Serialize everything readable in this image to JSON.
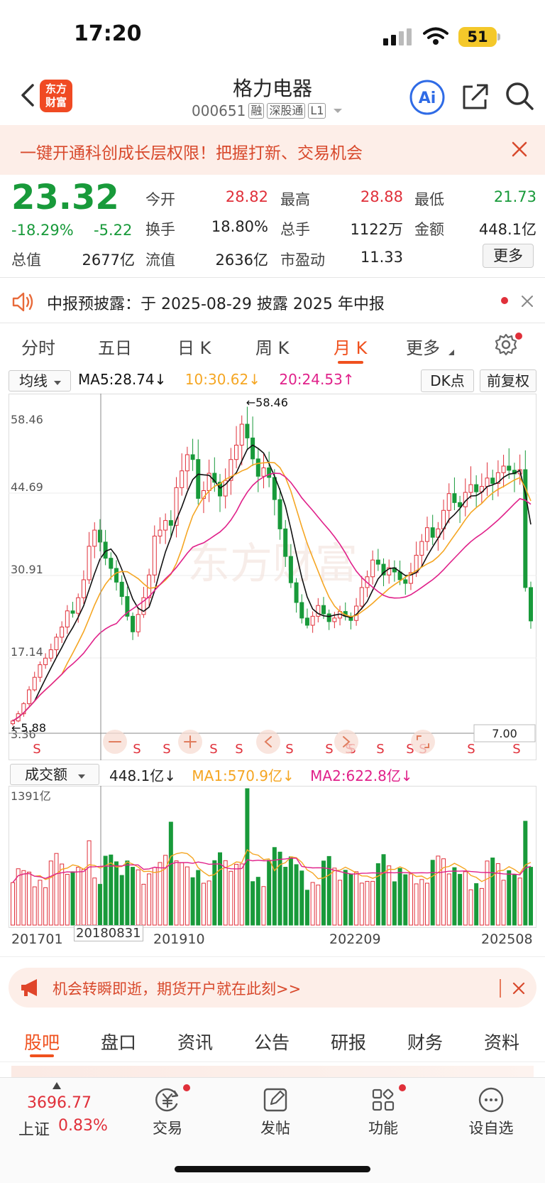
{
  "status_bar": {
    "time": "17:20",
    "battery": "51"
  },
  "header": {
    "title": "格力电器",
    "code": "000651",
    "tags": [
      "融",
      "深股通",
      "L1"
    ],
    "logo_line1": "东方",
    "logo_line2": "财富",
    "ai_label": "Ai"
  },
  "promo": {
    "text": "一键开通科创成长层权限！把握打新、交易机会"
  },
  "quote": {
    "price": "23.32",
    "change_pct": "-18.29%",
    "change": "-5.22",
    "open_label": "今开",
    "open": "28.82",
    "high_label": "最高",
    "high": "28.88",
    "low_label": "最低",
    "low": "21.73",
    "turnover_label": "换手",
    "turnover": "18.80%",
    "volume_label": "总手",
    "volume": "1122万",
    "amount_label": "金额",
    "amount": "448.1亿",
    "mktcap_label": "总值",
    "mktcap": "2677亿",
    "float_label": "流值",
    "float": "2636亿",
    "pe_label": "市盈动",
    "pe": "11.33",
    "more_label": "更多"
  },
  "notice": {
    "text": "中报预披露：于 2025-08-29 披露 2025 年中报"
  },
  "period_tabs": [
    "分时",
    "五日",
    "日 K",
    "周 K",
    "月 K",
    "更多"
  ],
  "active_period": "月 K",
  "chart_toolbar": {
    "ma_select": "均线",
    "ma5": "MA5:28.74↓",
    "ma10": "10:30.62↓",
    "ma20": "20:24.53↑",
    "dk_label": "DK点",
    "adjust_label": "前复权"
  },
  "volume_toolbar": {
    "select": "成交额",
    "value": "448.1亿↓",
    "ma1": "MA1:570.9亿↓",
    "ma2": "MA2:622.8亿↓"
  },
  "ad": {
    "text": "机会转瞬即逝，期货开户就在此刻>>"
  },
  "section_tabs": [
    "股吧",
    "盘口",
    "资讯",
    "公告",
    "研报",
    "财务",
    "资料"
  ],
  "active_section": "股吧",
  "bottom_bar": {
    "index_value": "3696.77",
    "index_name": "上证",
    "index_pct": "0.83%",
    "nav": [
      {
        "label": "交易",
        "icon": "yen-exchange-icon",
        "dot": true
      },
      {
        "label": "发帖",
        "icon": "edit-post-icon",
        "dot": false
      },
      {
        "label": "功能",
        "icon": "grid-apps-icon",
        "dot": true
      },
      {
        "label": "设自选",
        "icon": "more-dots-icon",
        "dot": false
      }
    ]
  },
  "colors": {
    "up": "#e0303a",
    "down": "#189a3a",
    "accent": "#f0511e",
    "ma5": "#111111",
    "ma10": "#f5a623",
    "ma20": "#e0218a"
  },
  "chart_data": {
    "type": "candlestick",
    "title": "",
    "xlabel": "",
    "ylabel": "",
    "y_tick_labels": [
      "58.46",
      "44.69",
      "30.91",
      "17.14",
      "3.36"
    ],
    "ylim": [
      3.36,
      58.46
    ],
    "x_tick_labels": [
      "201701",
      "201910",
      "202209",
      "202508"
    ],
    "crosshair_date": "20180831",
    "max_label": "←58.46",
    "min_label": "←5.88",
    "crosshair_value": "7.00",
    "signal_label": "S",
    "dk_signal_count": 14,
    "volume_axis_label": "1391亿",
    "volume_max": 1391,
    "volume_unit": "亿",
    "monthly_closes": [
      6.6,
      7.8,
      9.5,
      11.8,
      13.9,
      16.0,
      17.1,
      18.5,
      20.6,
      22.3,
      25.0,
      24.6,
      27.2,
      30.2,
      35.8,
      38.5,
      36.5,
      33.8,
      32.1,
      29.8,
      27.4,
      24.1,
      21.5,
      24.4,
      27.2,
      31.0,
      37.5,
      38.5,
      40.1,
      39.3,
      45.6,
      48.4,
      51.1,
      50.3,
      43.8,
      45.1,
      48.0,
      46.5,
      44.2,
      46.8,
      50.3,
      52.7,
      56.2,
      53.9,
      50.4,
      47.5,
      48.9,
      47.3,
      43.6,
      38.7,
      34.1,
      29.7,
      26.4,
      23.8,
      22.6,
      24.1,
      25.9,
      24.5,
      23.2,
      23.8,
      24.9,
      24.1,
      23.4,
      25.8,
      28.9,
      30.7,
      33.5,
      32.8,
      31.0,
      32.2,
      31.5,
      30.2,
      29.6,
      31.4,
      34.3,
      36.6,
      38.9,
      37.3,
      38.7,
      41.8,
      44.6,
      43.1,
      42.4,
      44.8,
      46.1,
      44.9,
      45.8,
      47.2,
      46.3,
      48.1,
      49.2,
      48.5,
      47.9,
      48.6,
      28.9,
      23.32
    ]
  }
}
